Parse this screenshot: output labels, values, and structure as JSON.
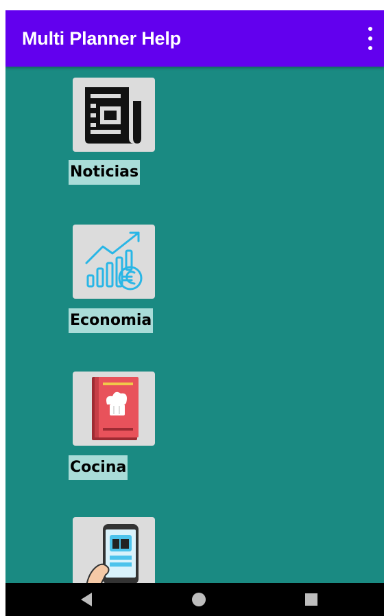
{
  "app": {
    "title": "Multi Planner Help"
  },
  "items": [
    {
      "label": "Noticias",
      "icon": "newspaper-icon"
    },
    {
      "label": "Economia",
      "icon": "economy-chart-euro-icon"
    },
    {
      "label": "Cocina",
      "icon": "cookbook-icon"
    },
    {
      "label": "",
      "icon": "tablet-ebook-icon"
    }
  ],
  "colors": {
    "appbar": "#6200ee",
    "background": "#1a8a82",
    "tile": "#dcdcdc",
    "label_bg": "#a9dcd8",
    "navbar": "#000000"
  }
}
